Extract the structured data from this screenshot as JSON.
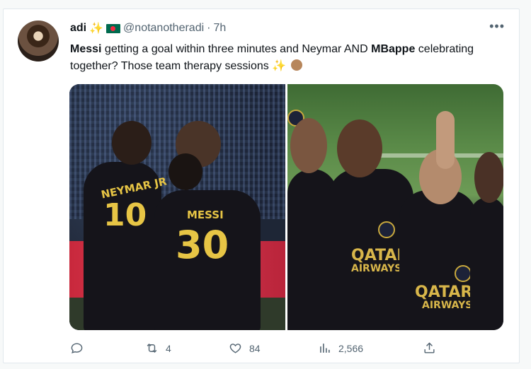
{
  "tweet": {
    "display_name": "adi",
    "handle": "@notanotheradi",
    "separator": "·",
    "time": "7h",
    "more_label": "•••",
    "text_parts": {
      "p1": "Messi",
      "p2": " getting a goal within three minutes and Neymar AND ",
      "p3": "MBappe",
      "p4": " celebrating together? Those team therapy sessions"
    },
    "emojis": [
      "sparkles-emoji",
      "ok-hand-emoji",
      "bangladesh-flag-emoji"
    ]
  },
  "media": {
    "left_photo": {
      "jersey_name_1": "NEYMAR JR",
      "jersey_number_1": "10",
      "jersey_name_2": "MESSI",
      "jersey_number_2": "30"
    },
    "right_photo": {
      "sponsor_line_1": "QATAR",
      "sponsor_line_2": "AIRWAYS"
    }
  },
  "actions": {
    "reply": {
      "icon": "reply-icon",
      "count": ""
    },
    "retweet": {
      "icon": "retweet-icon",
      "count": "4"
    },
    "like": {
      "icon": "heart-icon",
      "count": "84"
    },
    "views": {
      "icon": "views-icon",
      "count": "2,566"
    },
    "share": {
      "icon": "share-icon",
      "count": ""
    }
  },
  "colors": {
    "text": "#0f1419",
    "secondary": "#536471",
    "gold": "#e7c545"
  }
}
